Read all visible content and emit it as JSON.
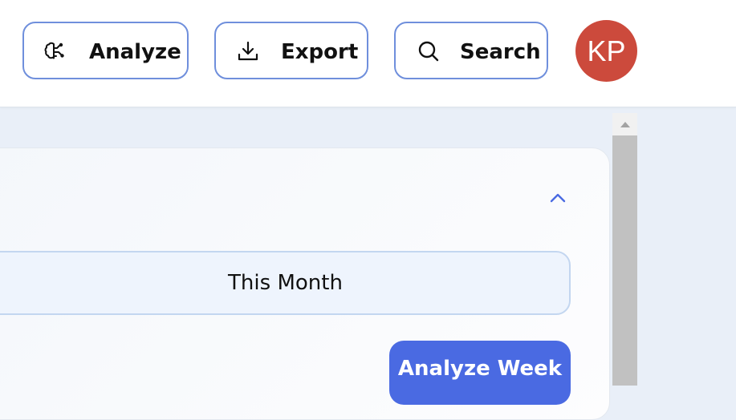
{
  "header": {
    "analyze_label": "Analyze",
    "export_label": "Export",
    "search_label": "Search",
    "avatar_initials": "KP"
  },
  "card": {
    "period_label": "This Month",
    "analyze_week_label": "Analyze Week"
  },
  "icons": {
    "analyze": "brain-icon",
    "export": "download-icon",
    "search": "search-icon",
    "collapse": "chevron-up-icon",
    "scroll_up": "triangle-up-icon"
  },
  "colors": {
    "button_border": "#6f8fdc",
    "avatar_bg": "#cc4a3c",
    "primary": "#4a6ae2",
    "period_bg": "#eef4fd",
    "page_bg": "#e9eff8"
  }
}
